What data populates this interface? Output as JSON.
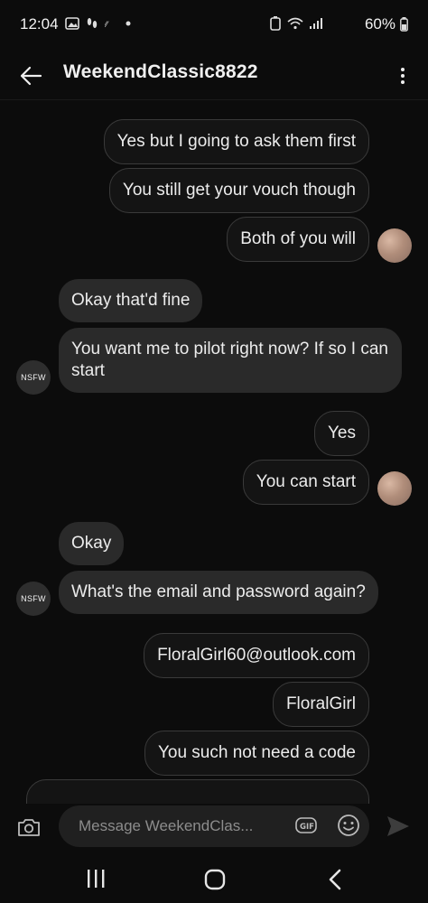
{
  "status_bar": {
    "time": "12:04",
    "battery": "60%"
  },
  "header": {
    "title": "WeekendClassic8822"
  },
  "messages": [
    {
      "from": "me",
      "text": "Yes but I going to ask them first"
    },
    {
      "from": "me",
      "text": "You still get your vouch though"
    },
    {
      "from": "me",
      "text": "Both of you will"
    },
    {
      "from": "them",
      "text": "Okay that'd fine"
    },
    {
      "from": "them",
      "text": "You want me to pilot right now? If so I can start"
    },
    {
      "from": "me",
      "text": "Yes"
    },
    {
      "from": "me",
      "text": "You can start"
    },
    {
      "from": "them",
      "text": "Okay"
    },
    {
      "from": "them",
      "text": "What's the email and password again?"
    },
    {
      "from": "me",
      "text": "FloralGirl60@outlook.com"
    },
    {
      "from": "me",
      "text": "FloralGirl"
    },
    {
      "from": "me",
      "text": "You such not need a code"
    }
  ],
  "contact_avatar_label": "NSFW",
  "composer": {
    "placeholder": "Message WeekendClas..."
  },
  "colors": {
    "background": "#0c0c0c",
    "incoming_bubble": "#2a2a2a",
    "outgoing_border": "#3a3a3a"
  },
  "icons": [
    "back-arrow-icon",
    "more-vert-icon",
    "camera-icon",
    "gif-icon",
    "emoji-icon",
    "send-icon",
    "nav-recents-icon",
    "nav-home-icon",
    "nav-back-icon"
  ]
}
